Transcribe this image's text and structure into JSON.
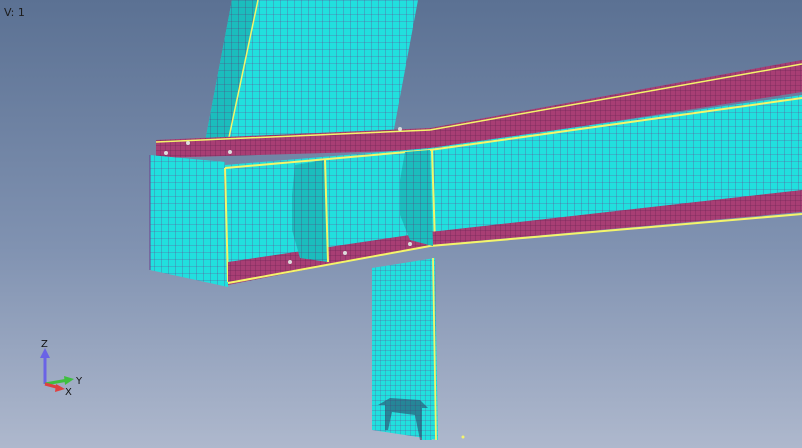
{
  "viewport": {
    "view_label": "V: 1",
    "background_top": "#5b7193",
    "background_bottom": "#aeb8cd"
  },
  "mesh_colors": {
    "surface": "#21e0de",
    "mesh_lines": "#6e3f8c",
    "flange": "#a83e74",
    "edge_highlight": "#f4f56a"
  },
  "axis_triad": {
    "z_label": "Z",
    "y_label": "Y",
    "x_label": "X",
    "z_color": "#6a63e6",
    "y_color": "#3fbf3f",
    "x_color": "#e04040"
  }
}
